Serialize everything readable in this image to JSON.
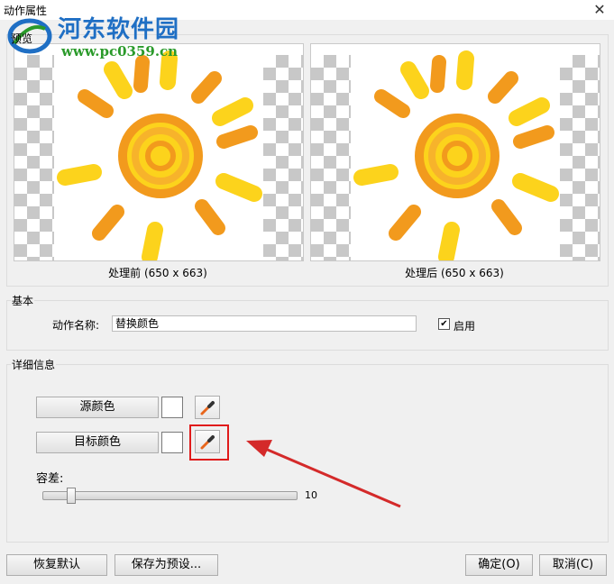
{
  "window": {
    "title": "动作属性",
    "close_glyph": "✕"
  },
  "watermark": {
    "site_name": "河东软件园",
    "url": "www.pc0359.cn",
    "preview_label": "预览"
  },
  "preview": {
    "before_caption": "处理前 (650 x 663)",
    "after_caption": "处理后 (650 x 663)"
  },
  "basic": {
    "group_label": "基本",
    "action_name_label": "动作名称:",
    "action_name_value": "替换颜色",
    "enabled_label": "启用",
    "enabled_checked": true
  },
  "details": {
    "group_label": "详细信息",
    "source_color_label": "源颜色",
    "target_color_label": "目标颜色",
    "source_color": "#ffffff",
    "target_color": "#ffffff",
    "picker_icon": "eyedropper-icon",
    "tolerance_label": "容差:",
    "tolerance_value": "10",
    "tolerance_fraction": 0.1
  },
  "footer": {
    "restore_default": "恢复默认",
    "save_preset": "保存为预设...",
    "ok": "确定(O)",
    "cancel": "取消(C)"
  },
  "colors": {
    "sun_orange": "#f29a1d",
    "sun_yellow": "#fcd31c",
    "highlight": "#e01b1b",
    "arrow": "#d42a2a",
    "watermark_blue": "#1f6fc4",
    "watermark_green": "#2a9a2a"
  }
}
